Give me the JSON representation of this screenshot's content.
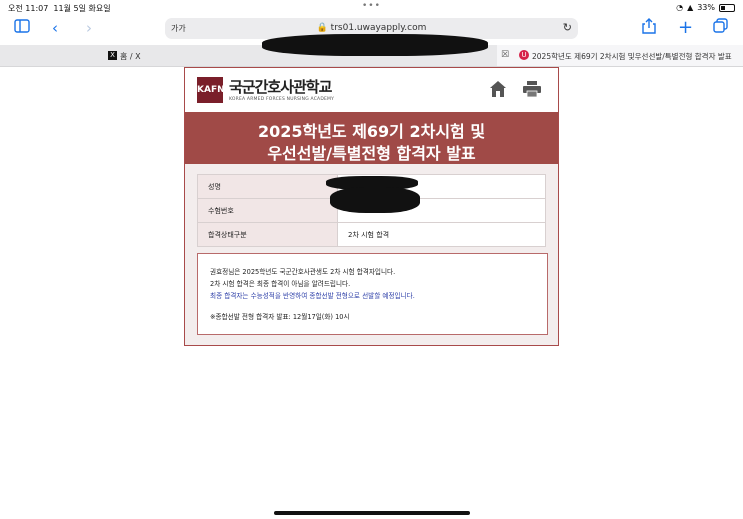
{
  "status_bar": {
    "time": "오전 11:07",
    "date": "11월 5일 화요일",
    "battery": "33%"
  },
  "toolbar": {
    "reader_label": "가가",
    "url": "trs01.uwayapply.com"
  },
  "tabs": [
    {
      "label": "홈 / X",
      "favicon": "X"
    },
    {
      "label": "2025학년도 제69기 2차시험 및우선선발/특별전형 합격자 발표",
      "favicon": "U"
    }
  ],
  "school": {
    "name": "국군간호사관학교",
    "name_en": "KOREA ARMED FORCES NURSING ACADEMY",
    "logo_text": "KAFNA"
  },
  "banner": {
    "line1": "2025학년도 제69기 2차시험 및",
    "line2": "우선선발/특별전형 합격자 발표"
  },
  "info_rows": [
    {
      "label": "성명",
      "value": ""
    },
    {
      "label": "수험번호",
      "value": ""
    },
    {
      "label": "합격상태구분",
      "value": "2차 시험 합격"
    }
  ],
  "notice": {
    "line1": "권효정님은 2025학년도 국군간호사관생도 2차 시험 합격자입니다.",
    "line2": "2차 시험 합격은 최종 합격이 아님을 알려드립니다.",
    "line3": "최종 합격자는 수능성적을 반영하여 종합선발 전형으로 선발할 예정입니다.",
    "line4": "※종합선발 전형 합격자 발표: 12월17일(화) 10시"
  },
  "colors": {
    "accent": "#a04a47",
    "link_blue": "#2d3fa8",
    "safari_blue": "#1a73e8"
  }
}
